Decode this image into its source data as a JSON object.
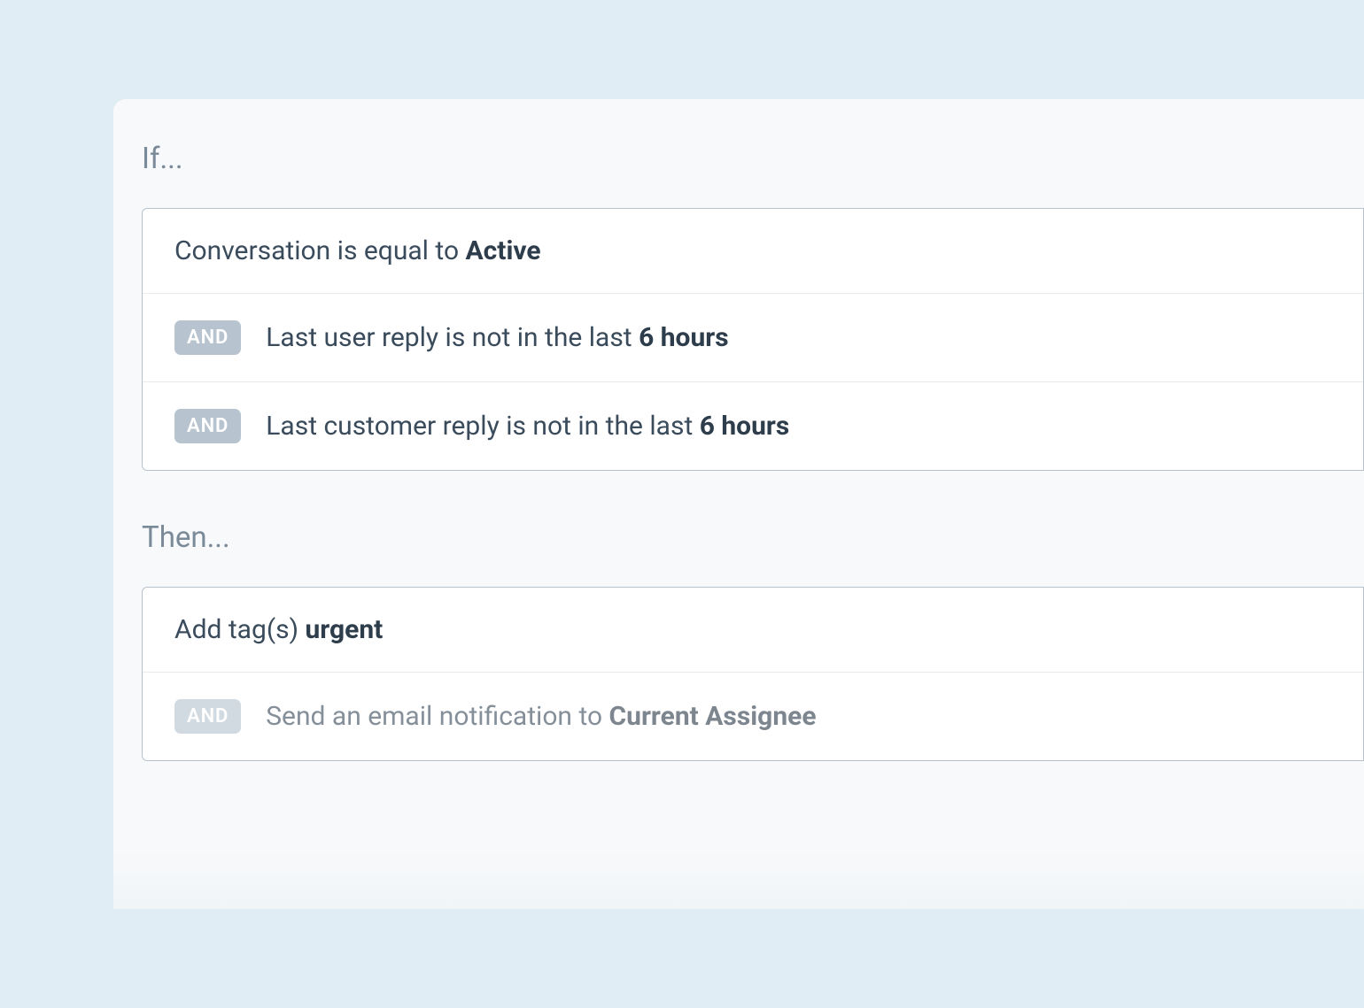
{
  "if_section": {
    "heading": "If...",
    "conditions": [
      {
        "conjunction": null,
        "text_prefix": "Conversation is equal to ",
        "text_bold": "Active",
        "text_suffix": ""
      },
      {
        "conjunction": "AND",
        "text_prefix": "Last user reply is not in the last ",
        "text_bold": "6 hours",
        "text_suffix": ""
      },
      {
        "conjunction": "AND",
        "text_prefix": "Last customer reply is not in the last ",
        "text_bold": "6 hours",
        "text_suffix": ""
      }
    ]
  },
  "then_section": {
    "heading": "Then...",
    "actions": [
      {
        "conjunction": null,
        "text_prefix": "Add tag(s) ",
        "text_bold": "urgent",
        "text_suffix": ""
      },
      {
        "conjunction": "AND",
        "text_prefix": "Send an email notification to ",
        "text_bold": "Current Assignee",
        "text_suffix": ""
      }
    ]
  }
}
